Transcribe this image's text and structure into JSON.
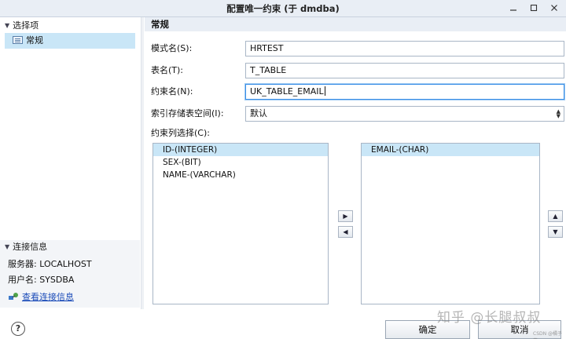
{
  "window": {
    "title": "配置唯一约束 (于 dmdba)",
    "controls": [
      "minimize-icon",
      "maximize-icon",
      "close-icon"
    ]
  },
  "sidebar": {
    "section_label": "选择项",
    "items": [
      {
        "label": "常规",
        "icon": "page-icon",
        "selected": true
      }
    ],
    "conn_section_label": "连接信息",
    "server": "服务器: LOCALHOST",
    "user": "用户名: SYSDBA",
    "view_conn_link": "查看连接信息"
  },
  "main": {
    "heading": "常规",
    "schema_label": "模式名(S):",
    "schema_value": "HRTEST",
    "table_label": "表名(T):",
    "table_value": "T_TABLE",
    "constraint_label": "约束名(N):",
    "constraint_value": "UK_TABLE_EMAIL",
    "tablespace_label": "索引存储表空间(I):",
    "tablespace_value": "默认",
    "columns_label": "约束列选择(C):",
    "available_columns": [
      {
        "label": "ID-(INTEGER)",
        "selected": true
      },
      {
        "label": "SEX-(BIT)",
        "selected": false
      },
      {
        "label": "NAME-(VARCHAR)",
        "selected": false
      }
    ],
    "selected_columns": [
      {
        "label": "EMAIL-(CHAR)",
        "selected": true
      }
    ]
  },
  "footer": {
    "ok_label": "确定",
    "cancel_label": "取消"
  },
  "watermark": {
    "main": "知乎 @长腿叔叔",
    "small": "CSDN @橘子慕"
  },
  "colors": {
    "selection": "#c9e6f7",
    "focus_border": "#3a8ee6",
    "link": "#1a4bb8"
  }
}
